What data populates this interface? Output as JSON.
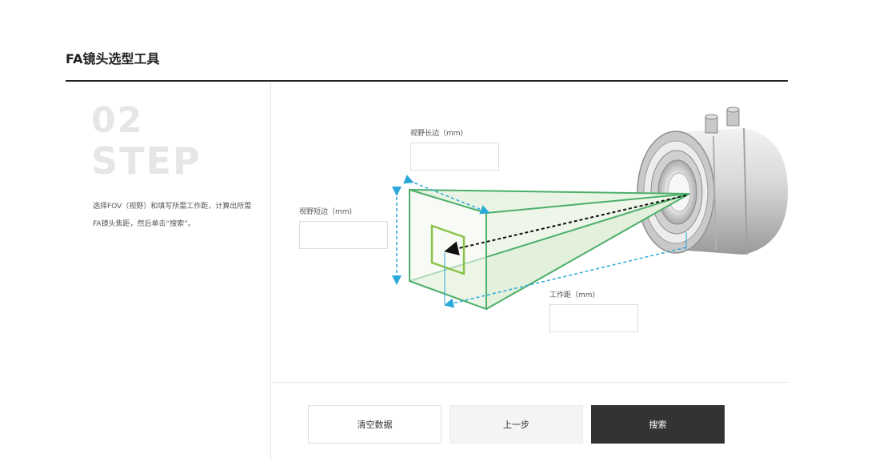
{
  "page": {
    "title": "FA镜头选型工具"
  },
  "step": {
    "number": "02",
    "word": "STEP",
    "description": "选择FOV（视野）和填写所需工作距，计算出所需FA镜头焦距，然后单击“搜索”。"
  },
  "fields": {
    "fov_long": {
      "label": "视野长边（mm)",
      "value": ""
    },
    "fov_short": {
      "label": "视野短边（mm)",
      "value": ""
    },
    "working_distance": {
      "label": "工作距（mm)",
      "value": ""
    }
  },
  "buttons": {
    "clear": "清空数据",
    "prev": "上一步",
    "search": "搜索"
  },
  "colors": {
    "accent_green": "#4caf6a",
    "accent_blue": "#29a9d8",
    "dark_button": "#333333"
  }
}
